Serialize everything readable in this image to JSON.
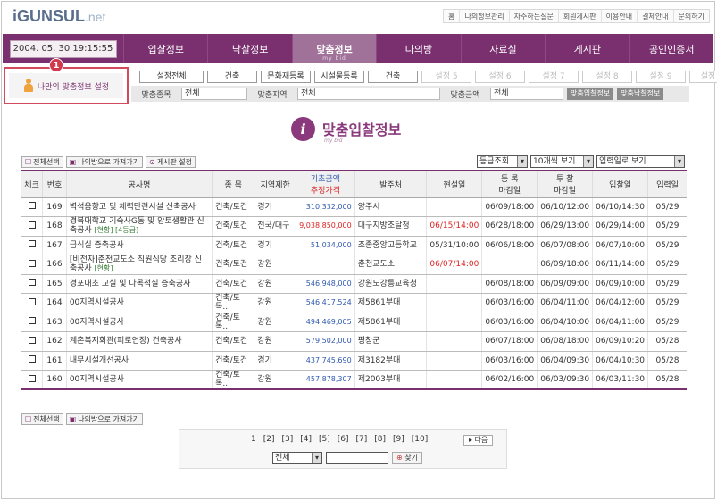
{
  "logo": {
    "brand": "iGUNSUL",
    "suffix": ".net"
  },
  "toplinks": [
    "홈",
    "나의정보관리",
    "자주하는질문",
    "회원게시판",
    "이용안내",
    "결제안내",
    "문의하기"
  ],
  "datetime": "2004. 05. 30  19:15:55",
  "nav": [
    {
      "label": "입찰정보"
    },
    {
      "label": "낙찰정보"
    },
    {
      "label": "맞춤정보",
      "sub": "my bid",
      "active": true
    },
    {
      "label": "나의방"
    },
    {
      "label": "자료실"
    },
    {
      "label": "게시판"
    },
    {
      "label": "공인인증서"
    }
  ],
  "sidebar": {
    "badge": "1",
    "label": "나만의 맞춤정보 설정"
  },
  "settings": [
    "설정전체",
    "건축",
    "문화재등록",
    "시설물등록",
    "건축",
    "설정 5",
    "설정 6",
    "설정 7",
    "설정 8",
    "설정 9",
    "설정 10"
  ],
  "filters": {
    "type_label": "맞춤종목",
    "type_value": "전체",
    "region_label": "맞춤지역",
    "region_value": "전체",
    "amount_label": "맞춤금액",
    "amount_value": "전체",
    "btn_bid": "맞춤입찰정보",
    "btn_award": "맞춤낙찰정보"
  },
  "title": {
    "main": "맞춤입찰정보",
    "sub": "my bid"
  },
  "toolbar": {
    "select_all": "전체선택",
    "save_to_room": "나의방으로 가져가기",
    "post_board": "게시판 설정"
  },
  "selects": {
    "grade": "등급조회",
    "perpage": "10개씩 보기",
    "sort": "입력일로 보기"
  },
  "table": {
    "headers": {
      "check": "체크",
      "no": "번호",
      "name": "공사명",
      "type": "종 목",
      "region": "지역제한",
      "amount1": "기초금액",
      "amount2": "추정가격",
      "client": "발주처",
      "site": "현설일",
      "reg1": "등  록",
      "reg2": "마감일",
      "bid1": "투  찰",
      "bid2": "마감일",
      "open": "입찰일",
      "input": "입력일"
    },
    "rows": [
      {
        "no": "169",
        "name": "벽석음향고 및 체력단련시설 신축공사",
        "tag": "",
        "type": "건축/토건",
        "region": "경기",
        "amount": "310,332,000",
        "client": "양주시",
        "site": "",
        "site_red": false,
        "reg": "06/09/18:00",
        "bid": "06/10/12:00",
        "open": "06/10/14:30",
        "input": "05/29"
      },
      {
        "no": "168",
        "name": "경북대학교 기숙사G동 및 양토생활관 신축공사",
        "tag": "[현황] [4등급]",
        "type": "건축/토건",
        "region": "전국/대구",
        "amount": "9,038,850,000",
        "amount_red": true,
        "client": "대구지방조달청",
        "site": "06/15/14:00",
        "site_red": true,
        "reg": "06/28/18:00",
        "bid": "06/29/13:00",
        "open": "06/29/14:00",
        "input": "05/29"
      },
      {
        "no": "167",
        "name": "급식실 증축공사",
        "tag": "",
        "type": "건축/토건",
        "region": "경기",
        "amount": "51,034,000",
        "client": "조종중앙고등학교",
        "site": "05/31/10:00",
        "site_red": false,
        "reg": "06/06/18:00",
        "bid": "06/07/08:00",
        "open": "06/07/10:00",
        "input": "05/29"
      },
      {
        "no": "166",
        "name": "[비전자]춘천교도소 직원식당 조리장 신축공사",
        "tag": "[현황]",
        "type": "건축/토건",
        "region": "강원",
        "amount": "",
        "client": "춘천교도소",
        "site": "06/07/14:00",
        "site_red": true,
        "reg": "",
        "bid": "06/09/18:00",
        "open": "06/11/14:00",
        "input": "05/29"
      },
      {
        "no": "165",
        "name": "경포대초 교실 및 다목적실 증축공사",
        "tag": "",
        "type": "건축/토건",
        "region": "강원",
        "amount": "546,948,000",
        "client": "강원도강릉교육청",
        "site": "",
        "site_red": false,
        "reg": "06/08/18:00",
        "bid": "06/09/09:00",
        "open": "06/09/10:00",
        "input": "05/29"
      },
      {
        "no": "164",
        "name": "00지역시설공사",
        "tag": "",
        "type": "건축/토목..",
        "region": "강원",
        "amount": "546,417,524",
        "client": "제5861부대",
        "site": "",
        "site_red": false,
        "reg": "06/03/16:00",
        "bid": "06/04/11:00",
        "open": "06/04/12:00",
        "input": "05/29"
      },
      {
        "no": "163",
        "name": "00지역시설공사",
        "tag": "",
        "type": "건축/토목..",
        "region": "강원",
        "amount": "494,469,005",
        "client": "제5861부대",
        "site": "",
        "site_red": false,
        "reg": "06/03/16:00",
        "bid": "06/04/10:00",
        "open": "06/04/11:00",
        "input": "05/29"
      },
      {
        "no": "162",
        "name": "계촌복지회관(피로연장) 건축공사",
        "tag": "",
        "type": "건축/토건",
        "region": "강원",
        "amount": "579,502,000",
        "client": "평창군",
        "site": "",
        "site_red": false,
        "reg": "06/07/18:00",
        "bid": "06/08/18:00",
        "open": "06/09/10:20",
        "input": "05/28"
      },
      {
        "no": "161",
        "name": "내무시설개선공사",
        "tag": "",
        "type": "건축/토건",
        "region": "경기",
        "amount": "437,745,690",
        "client": "제3182부대",
        "site": "",
        "site_red": false,
        "reg": "06/03/16:00",
        "bid": "06/04/09:30",
        "open": "06/04/10:30",
        "input": "05/28"
      },
      {
        "no": "160",
        "name": "00지역시설공사",
        "tag": "",
        "type": "건축/토목..",
        "region": "강원",
        "amount": "457,878,307",
        "client": "제2003부대",
        "site": "",
        "site_red": false,
        "reg": "06/02/16:00",
        "bid": "06/03/09:30",
        "open": "06/03/11:30",
        "input": "05/28"
      }
    ]
  },
  "pager": {
    "pages": [
      "1",
      "[2]",
      "[3]",
      "[4]",
      "[5]",
      "[6]",
      "[7]",
      "[8]",
      "[9]",
      "[10]"
    ],
    "next": "다음",
    "search_select": "전체",
    "search_btn": "찾기"
  }
}
